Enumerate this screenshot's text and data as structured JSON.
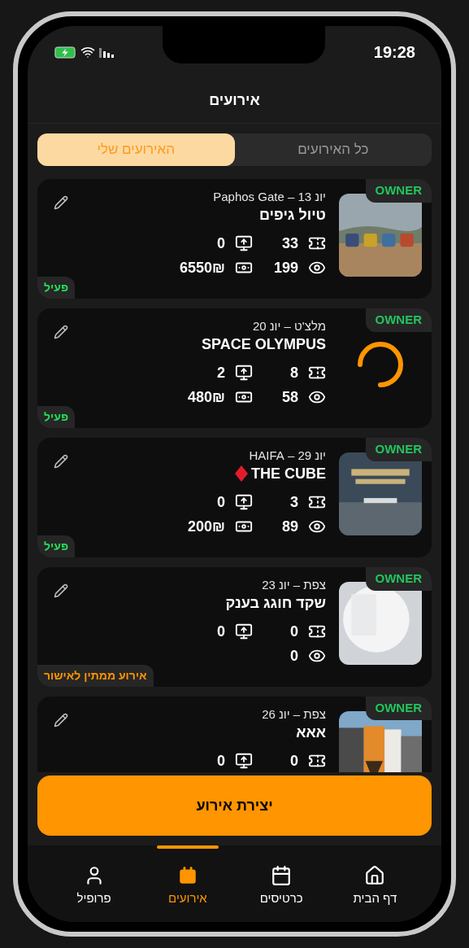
{
  "status_bar": {
    "time": "19:28"
  },
  "header": {
    "title": "אירועים"
  },
  "tabs": [
    {
      "label": "כל האירועים",
      "selected": false
    },
    {
      "label": "האירועים שלי",
      "selected": true
    }
  ],
  "events": [
    {
      "role": "OWNER",
      "media": {
        "kind": "picture"
      },
      "date_line": "יונ 13 – Paphos Gate",
      "title": "טיול גיפים",
      "featured": false,
      "stats": [
        {
          "kind": "tickets",
          "value": "33"
        },
        {
          "kind": "views",
          "value": "199"
        },
        {
          "kind": "shares",
          "value": "0"
        },
        {
          "kind": "revenue",
          "value": "6550₪"
        }
      ],
      "status": {
        "kind": "active",
        "label": "פעיל"
      }
    },
    {
      "role": "OWNER",
      "media": {
        "kind": "loading"
      },
      "date_line": "מלצ'ט – יונ 20",
      "title": "SPACE OLYMPUS",
      "featured": false,
      "stats": [
        {
          "kind": "tickets",
          "value": "8"
        },
        {
          "kind": "views",
          "value": "58"
        },
        {
          "kind": "shares",
          "value": "2"
        },
        {
          "kind": "revenue",
          "value": "480₪"
        }
      ],
      "status": {
        "kind": "active",
        "label": "פעיל"
      }
    },
    {
      "role": "OWNER",
      "media": {
        "kind": "picture"
      },
      "date_line": "יונ 29 – HAIFA",
      "title": "THE CUBE",
      "featured": true,
      "stats": [
        {
          "kind": "tickets",
          "value": "3"
        },
        {
          "kind": "views",
          "value": "89"
        },
        {
          "kind": "shares",
          "value": "0"
        },
        {
          "kind": "revenue",
          "value": "200₪"
        }
      ],
      "status": {
        "kind": "active",
        "label": "פעיל"
      }
    },
    {
      "role": "OWNER",
      "media": {
        "kind": "picture"
      },
      "date_line": "צפת – יונ 23",
      "title": "שקד חוגג בענק",
      "featured": false,
      "stats": [
        {
          "kind": "tickets",
          "value": "0"
        },
        {
          "kind": "views",
          "value": "0"
        },
        {
          "kind": "shares",
          "value": "0"
        }
      ],
      "status": {
        "kind": "pending",
        "label": "אירוע ממתין לאישור"
      }
    },
    {
      "role": "OWNER",
      "media": {
        "kind": "picture"
      },
      "date_line": "צפת – יונ 26",
      "title": "אאא",
      "featured": false,
      "stats": [
        {
          "kind": "tickets",
          "value": "0"
        },
        {
          "kind": "shares",
          "value": "0"
        }
      ]
    }
  ],
  "create_button": {
    "label": "יצירת אירוע"
  },
  "bottom_nav": [
    {
      "kind": "home",
      "label": "דף הבית",
      "selected": false
    },
    {
      "kind": "tickets",
      "label": "כרטיסים",
      "selected": false
    },
    {
      "kind": "events",
      "label": "אירועים",
      "selected": true
    },
    {
      "kind": "profile",
      "label": "פרופיל",
      "selected": false
    }
  ]
}
